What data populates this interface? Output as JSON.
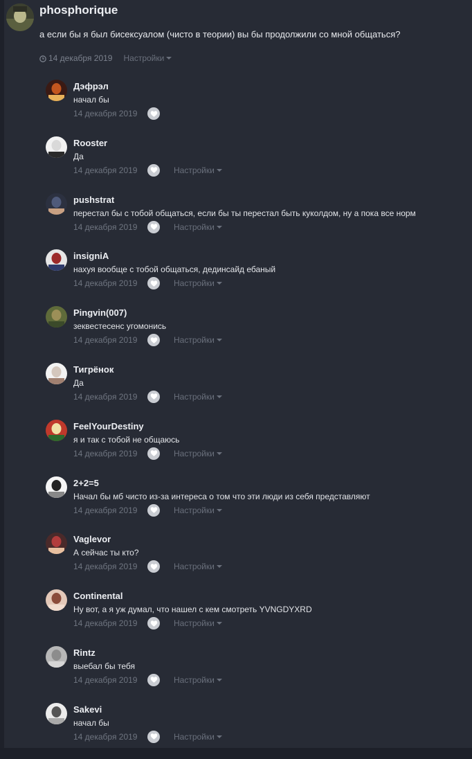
{
  "post": {
    "author": "phosphorique",
    "text": "а если бы я был бисексуалом (чисто в теории) вы бы продолжили со мной общаться?",
    "date": "14 декабря 2019",
    "settings_label": "Настройки"
  },
  "comments": [
    {
      "author": "Дэфрэл",
      "text": "начал бы",
      "date": "14 декабря 2019",
      "settings": ""
    },
    {
      "author": "Rooster",
      "text": "Да",
      "date": "14 декабря 2019",
      "settings": "Настройки"
    },
    {
      "author": "pushstrat",
      "text": "перестал бы с тобой общаться, если бы ты перестал быть куколдом, ну а пока все норм",
      "date": "14 декабря 2019",
      "settings": "Настройки"
    },
    {
      "author": "insigniA",
      "text": "нахуя вообще с тобой общаться, дединсайд ебаный",
      "date": "14 декабря 2019",
      "settings": "Настройки"
    },
    {
      "author": "Pingvin(007)",
      "text": "зеквестесенс угомонись",
      "date": "14 декабря 2019",
      "settings": "Настройки"
    },
    {
      "author": "Тигрёнок",
      "text": "Да",
      "date": "14 декабря 2019",
      "settings": "Настройки"
    },
    {
      "author": "FeelYourDestiny",
      "text": "я и так с тобой не общаюсь",
      "date": "14 декабря 2019",
      "settings": "Настройки"
    },
    {
      "author": "2+2=5",
      "text": "Начал бы мб чисто из-за интереса о том что эти люди из себя представляют",
      "date": "14 декабря 2019",
      "settings": "Настройки"
    },
    {
      "author": "Vaglevor",
      "text": "А сейчас ты кто?",
      "date": "14 декабря 2019",
      "settings": "Настройки"
    },
    {
      "author": "Continental",
      "text": "Ну вот, а я уж думал, что нашел с кем смотреть YVNGDYXRD",
      "date": "14 декабря 2019",
      "settings": "Настройки"
    },
    {
      "author": "Rintz",
      "text": "выебал бы тебя",
      "date": "14 декабря 2019",
      "settings": "Настройки"
    },
    {
      "author": "Sakevi",
      "text": "начал бы",
      "date": "14 декабря 2019",
      "settings": "Настройки"
    }
  ],
  "icons": {
    "clock": "clock-icon",
    "like": "heart-icon",
    "settings_dropdown": "caret-down-icon"
  },
  "colors": {
    "background": "#272b35",
    "text_muted": "#6f7580",
    "like_button": "#c9ccd2"
  }
}
